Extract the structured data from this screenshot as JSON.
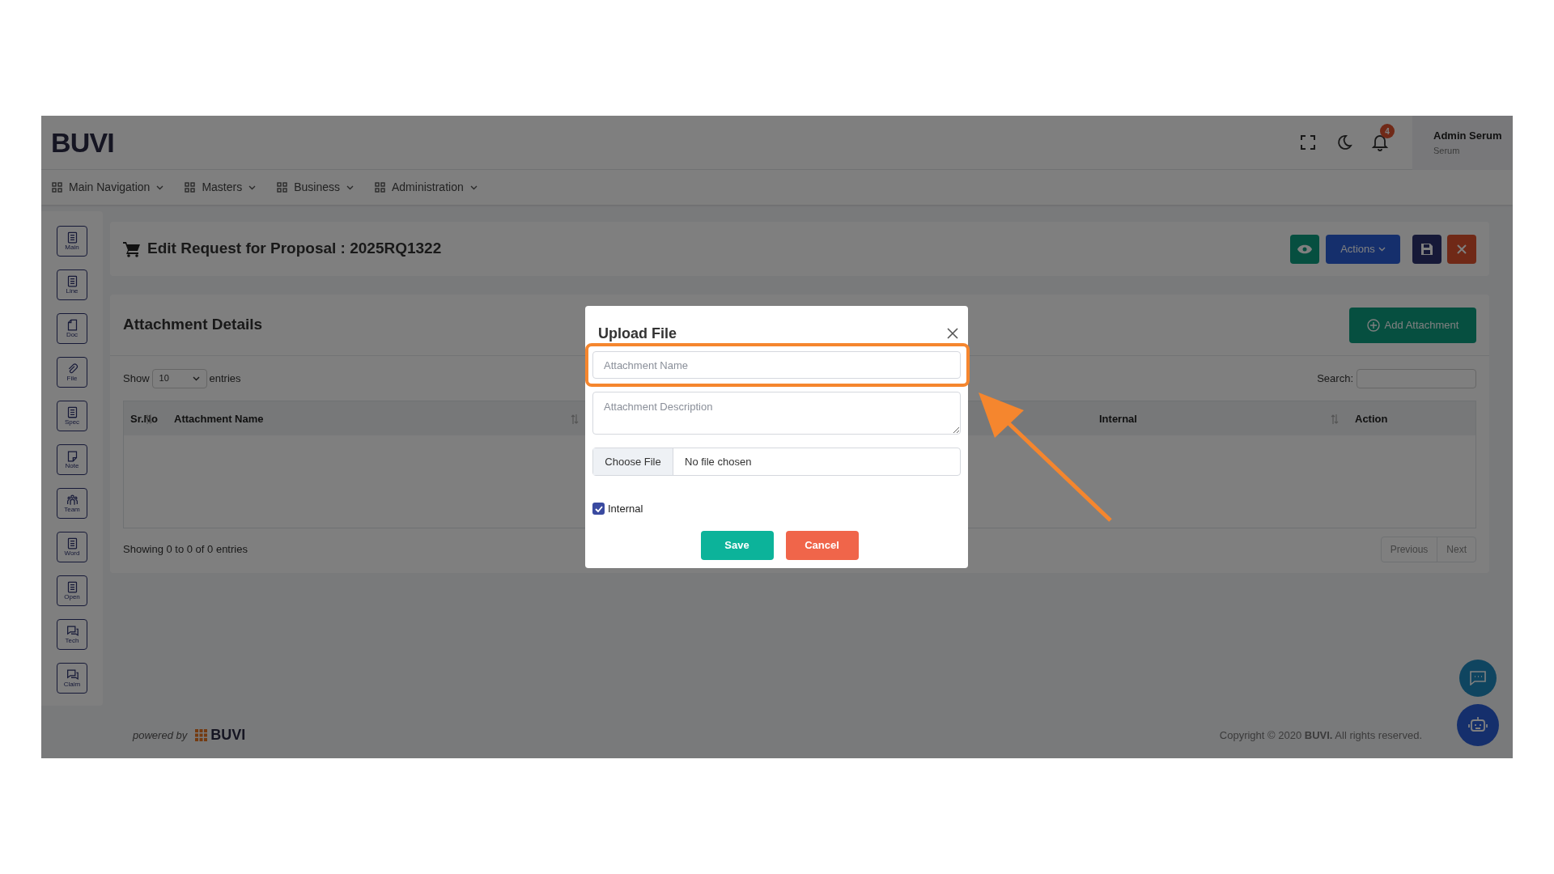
{
  "header": {
    "logo": "BUVI",
    "notification_count": "4",
    "user": {
      "name": "Admin Serum",
      "role": "Serum"
    }
  },
  "nav": [
    {
      "label": "Main Navigation"
    },
    {
      "label": "Masters"
    },
    {
      "label": "Business"
    },
    {
      "label": "Administration"
    }
  ],
  "sidebar": [
    {
      "label": "Main",
      "kind": "list"
    },
    {
      "label": "Line",
      "kind": "list"
    },
    {
      "label": "Doc",
      "kind": "page"
    },
    {
      "label": "File",
      "kind": "clip"
    },
    {
      "label": "Spec",
      "kind": "list"
    },
    {
      "label": "Note",
      "kind": "note"
    },
    {
      "label": "Team",
      "kind": "team"
    },
    {
      "label": "Word",
      "kind": "list"
    },
    {
      "label": "Open",
      "kind": "list"
    },
    {
      "label": "Tech",
      "kind": "chat"
    },
    {
      "label": "Claim",
      "kind": "chat"
    }
  ],
  "page_title": "Edit Request for Proposal : 2025RQ1322",
  "toolbar": {
    "actions_label": "Actions"
  },
  "attachments": {
    "title": "Attachment Details",
    "add_button": "Add Attachment",
    "show_label": "Show",
    "page_size": "10",
    "entries_label": "entries",
    "search_label": "Search:",
    "columns": [
      {
        "label": "Sr.No",
        "sortable": true
      },
      {
        "label": "Attachment Name",
        "sortable": true
      },
      {
        "label": "Internal",
        "sortable": true
      },
      {
        "label": "Action",
        "sortable": false
      }
    ],
    "summary": "Showing 0 to 0 of 0 entries",
    "pagination": [
      "Previous",
      "Next"
    ]
  },
  "footer": {
    "powered_by": "powered by",
    "brand": "BUVI",
    "copyright": "Copyright © 2020 **BUVI.** All rights reserved."
  },
  "modal": {
    "title": "Upload File",
    "name_placeholder": "Attachment Name",
    "description_placeholder": "Attachment Description",
    "file_button": "Choose File",
    "file_status": "No file chosen",
    "internal": {
      "label": "Internal",
      "checked": true
    },
    "buttons": [
      {
        "label": "Save",
        "kind": "primary"
      },
      {
        "label": "Cancel",
        "kind": "danger"
      }
    ]
  }
}
